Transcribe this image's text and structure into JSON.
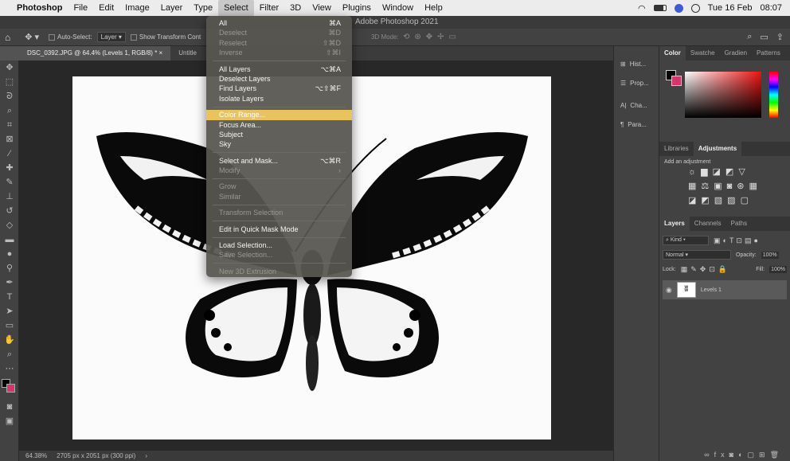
{
  "macmenu": {
    "apple": "",
    "app": "Photoshop",
    "items": [
      "File",
      "Edit",
      "Image",
      "Layer",
      "Type",
      "Select",
      "Filter",
      "3D",
      "View",
      "Plugins",
      "Window",
      "Help"
    ],
    "date": "Tue 16 Feb",
    "time": "08:07"
  },
  "window_title": "Adobe Photoshop 2021",
  "options": {
    "auto_select": "Auto-Select:",
    "layer": "Layer",
    "show_transform": "Show Transform Cont",
    "mode3d": "3D Mode:"
  },
  "tabs": [
    "DSC_0392.JPG @ 64.4% (Levels 1, RGB/8) *",
    "Untitle"
  ],
  "status": {
    "zoom": "64.38%",
    "size": "2705 px x 2051 px (300 ppi)"
  },
  "dock": [
    "Hist...",
    "Prop...",
    "Cha...",
    "Para..."
  ],
  "color_panel": {
    "tabs": [
      "Color",
      "Swatche",
      "Gradien",
      "Patterns"
    ]
  },
  "adj_panel": {
    "tabs": [
      "Libraries",
      "Adjustments"
    ],
    "label": "Add an adjustment"
  },
  "layers_panel": {
    "tabs": [
      "Layers",
      "Channels",
      "Paths"
    ],
    "kind": "Kind",
    "blend": "Normal",
    "opacity_label": "Opacity:",
    "opacity": "100%",
    "lock_label": "Lock:",
    "fill_label": "Fill:",
    "fill": "100%",
    "layer_name": "Levels 1"
  },
  "select_menu": [
    {
      "label": "All",
      "sc": "⌘A",
      "state": "normal"
    },
    {
      "label": "Deselect",
      "sc": "⌘D",
      "state": "disabled"
    },
    {
      "label": "Reselect",
      "sc": "⇧⌘D",
      "state": "disabled"
    },
    {
      "label": "Inverse",
      "sc": "⇧⌘I",
      "state": "disabled"
    },
    {
      "sep": true
    },
    {
      "label": "All Layers",
      "sc": "⌥⌘A",
      "state": "normal"
    },
    {
      "label": "Deselect Layers",
      "sc": "",
      "state": "normal"
    },
    {
      "label": "Find Layers",
      "sc": "⌥⇧⌘F",
      "state": "normal"
    },
    {
      "label": "Isolate Layers",
      "sc": "",
      "state": "normal"
    },
    {
      "sep": true
    },
    {
      "label": "Color Range...",
      "sc": "",
      "state": "highlighted"
    },
    {
      "label": "Focus Area...",
      "sc": "",
      "state": "normal"
    },
    {
      "label": "Subject",
      "sc": "",
      "state": "normal"
    },
    {
      "label": "Sky",
      "sc": "",
      "state": "normal"
    },
    {
      "sep": true
    },
    {
      "label": "Select and Mask...",
      "sc": "⌥⌘R",
      "state": "normal"
    },
    {
      "label": "Modify",
      "sc": "›",
      "state": "disabled"
    },
    {
      "sep": true
    },
    {
      "label": "Grow",
      "sc": "",
      "state": "disabled"
    },
    {
      "label": "Similar",
      "sc": "",
      "state": "disabled"
    },
    {
      "sep": true
    },
    {
      "label": "Transform Selection",
      "sc": "",
      "state": "disabled"
    },
    {
      "sep": true
    },
    {
      "label": "Edit in Quick Mask Mode",
      "sc": "",
      "state": "normal"
    },
    {
      "sep": true
    },
    {
      "label": "Load Selection...",
      "sc": "",
      "state": "normal"
    },
    {
      "label": "Save Selection...",
      "sc": "",
      "state": "disabled"
    },
    {
      "sep": true
    },
    {
      "label": "New 3D Extrusion",
      "sc": "",
      "state": "disabled"
    }
  ]
}
